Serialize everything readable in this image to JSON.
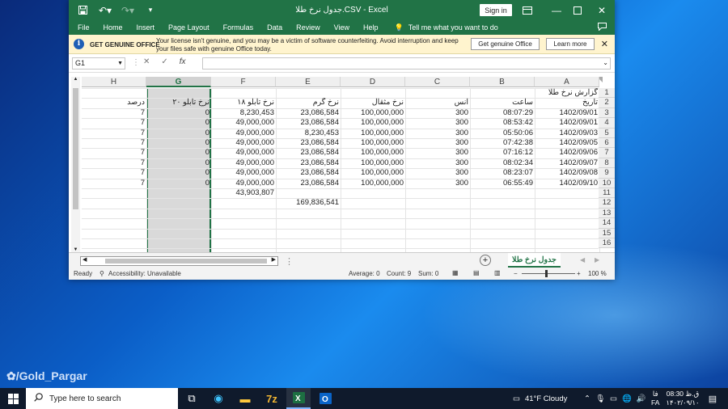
{
  "window": {
    "title": "جدول نرخ طلا.CSV  -  Excel",
    "sign_in": "Sign in"
  },
  "menu": [
    "File",
    "Home",
    "Insert",
    "Page Layout",
    "Formulas",
    "Data",
    "Review",
    "View",
    "Help"
  ],
  "tell_me": "Tell me what you want to do",
  "message_bar": {
    "title": "GET GENUINE OFFICE",
    "text": "Your license isn't genuine, and you may be a victim of software counterfeiting. Avoid interruption and keep your files safe with genuine Office today.",
    "btn_get": "Get genuine Office",
    "btn_learn": "Learn more"
  },
  "formula_bar": {
    "name_box": "G1",
    "fx": "fx",
    "cancel": "✕",
    "enter": "✓"
  },
  "columns": [
    "H",
    "G",
    "F",
    "E",
    "D",
    "C",
    "B",
    "A"
  ],
  "rows": [
    "1",
    "2",
    "3",
    "4",
    "5",
    "6",
    "7",
    "8",
    "9",
    "10",
    "11",
    "12",
    "13",
    "14",
    "15",
    "16"
  ],
  "sheet": {
    "a1": "گزارش نرخ طلا",
    "headers": {
      "A": "تاریخ",
      "B": "ساعت",
      "C": "انس",
      "D": "نرخ مثقال",
      "E": "نرخ گرم",
      "F": "نرخ تابلو ۱۸",
      "G": "نرخ تابلو ۲۰",
      "H": "درصد"
    },
    "data": [
      {
        "A": "1402/09/01",
        "B": "08:07:29",
        "C": "300",
        "D": "100,000,000",
        "E": "23,086,584",
        "F": "8,230,453",
        "G": "0",
        "H": "7"
      },
      {
        "A": "1402/09/01",
        "B": "08:53:42",
        "C": "300",
        "D": "100,000,000",
        "E": "23,086,584",
        "F": "49,000,000",
        "G": "0",
        "H": "7"
      },
      {
        "A": "1402/09/03",
        "B": "05:50:06",
        "C": "300",
        "D": "100,000,000",
        "E": "8,230,453",
        "F": "49,000,000",
        "G": "0",
        "H": "7"
      },
      {
        "A": "1402/09/05",
        "B": "07:42:38",
        "C": "300",
        "D": "100,000,000",
        "E": "23,086,584",
        "F": "49,000,000",
        "G": "0",
        "H": "7"
      },
      {
        "A": "1402/09/06",
        "B": "07:16:12",
        "C": "300",
        "D": "100,000,000",
        "E": "23,086,584",
        "F": "49,000,000",
        "G": "0",
        "H": "7"
      },
      {
        "A": "1402/09/07",
        "B": "08:02:34",
        "C": "300",
        "D": "100,000,000",
        "E": "23,086,584",
        "F": "49,000,000",
        "G": "0",
        "H": "7"
      },
      {
        "A": "1402/09/08",
        "B": "08:23:07",
        "C": "300",
        "D": "100,000,000",
        "E": "23,086,584",
        "F": "49,000,000",
        "G": "0",
        "H": "7"
      },
      {
        "A": "1402/09/10",
        "B": "06:55:49",
        "C": "300",
        "D": "100,000,000",
        "E": "23,086,584",
        "F": "49,000,000",
        "G": "0",
        "H": "7"
      }
    ],
    "f11": "43,903,807",
    "e12": "169,836,541",
    "tab_name": "جدول نرخ طلا"
  },
  "status": {
    "ready": "Ready",
    "accessibility": "Accessibility: Unavailable",
    "average": "Average: 0",
    "count": "Count: 9",
    "sum": "Sum: 0",
    "zoom": "100 %"
  },
  "taskbar": {
    "search_placeholder": "Type here to search",
    "weather": "41°F  Cloudy",
    "lang_top": "فا",
    "lang_bottom": "FA",
    "time": "08:30 ق.ظ",
    "date": "۱۴۰۲/۰۹/۱۰"
  },
  "watermark": "/Gold_Pargar"
}
